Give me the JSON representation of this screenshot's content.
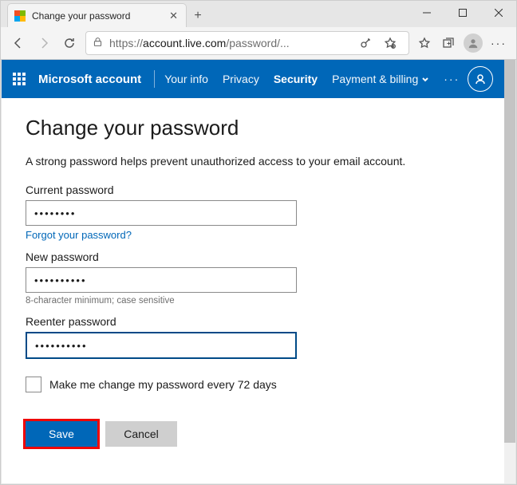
{
  "tab": {
    "title": "Change your password"
  },
  "address": {
    "protocol": "https://",
    "host": "account.live.com",
    "path": "/password/..."
  },
  "header": {
    "brand": "Microsoft account",
    "links": {
      "your_info": "Your info",
      "privacy": "Privacy",
      "security": "Security",
      "payment": "Payment & billing"
    }
  },
  "page": {
    "title": "Change your password",
    "subtitle": "A strong password helps prevent unauthorized access to your email account.",
    "current_label": "Current password",
    "current_value": "••••••••",
    "forgot_link": "Forgot your password?",
    "new_label": "New password",
    "new_value": "••••••••••",
    "hint": "8-character minimum; case sensitive",
    "reenter_label": "Reenter password",
    "reenter_value": "••••••••••",
    "checkbox_label": "Make me change my password every 72 days",
    "save": "Save",
    "cancel": "Cancel"
  }
}
